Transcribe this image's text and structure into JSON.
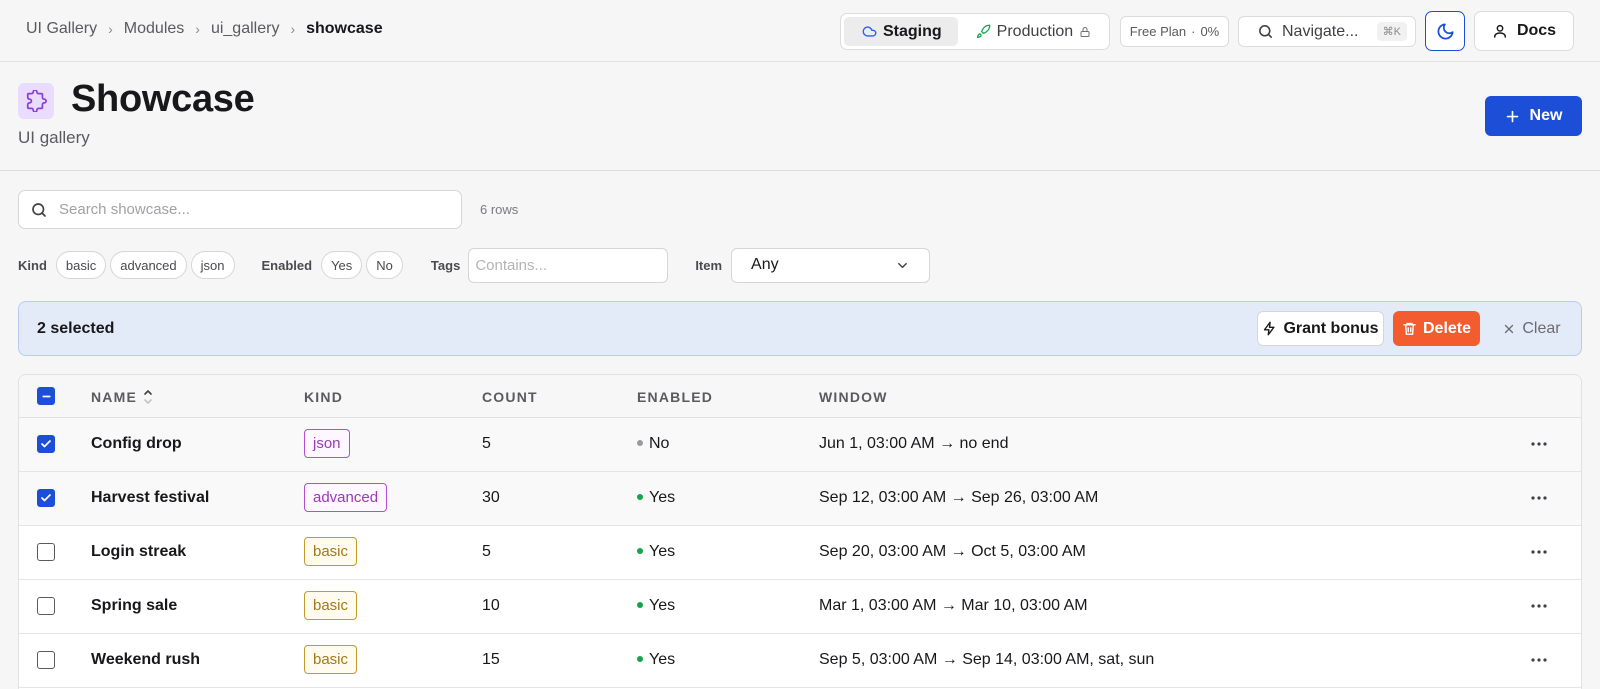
{
  "breadcrumb": [
    "UI Gallery",
    "Modules",
    "ui_gallery",
    "showcase"
  ],
  "env": {
    "staging": "Staging",
    "production": "Production"
  },
  "plan": {
    "label": "Free Plan",
    "usage": "0%"
  },
  "navigate": {
    "label": "Navigate...",
    "shortcut": "⌘K"
  },
  "docs_label": "Docs",
  "page": {
    "title": "Showcase",
    "subtitle": "UI gallery",
    "new_label": "New"
  },
  "search": {
    "placeholder": "Search showcase...",
    "row_count": "6 rows"
  },
  "filters": {
    "kind_label": "Kind",
    "kind_options": [
      "basic",
      "advanced",
      "json"
    ],
    "enabled_label": "Enabled",
    "enabled_options": [
      "Yes",
      "No"
    ],
    "tags_label": "Tags",
    "tags_placeholder": "Contains...",
    "item_label": "Item",
    "item_value": "Any"
  },
  "selection": {
    "text": "2 selected",
    "grant_label": "Grant bonus",
    "delete_label": "Delete",
    "clear_label": "Clear"
  },
  "table": {
    "columns": [
      "NAME",
      "KIND",
      "COUNT",
      "ENABLED",
      "WINDOW"
    ],
    "rows": [
      {
        "name": "Config drop",
        "kind": "json",
        "count": "5",
        "enabled": "No",
        "window": "Jun 1, 03:00 AM → no end",
        "checked": true
      },
      {
        "name": "Harvest festival",
        "kind": "advanced",
        "count": "30",
        "enabled": "Yes",
        "window": "Sep 12, 03:00 AM → Sep 26, 03:00 AM",
        "checked": true
      },
      {
        "name": "Login streak",
        "kind": "basic",
        "count": "5",
        "enabled": "Yes",
        "window": "Sep 20, 03:00 AM → Oct 5, 03:00 AM",
        "checked": false
      },
      {
        "name": "Spring sale",
        "kind": "basic",
        "count": "10",
        "enabled": "Yes",
        "window": "Mar 1, 03:00 AM → Mar 10, 03:00 AM",
        "checked": false
      },
      {
        "name": "Weekend rush",
        "kind": "basic",
        "count": "15",
        "enabled": "Yes",
        "window": "Sep 5, 03:00 AM → Sep 14, 03:00 AM, sat, sun",
        "checked": false
      }
    ]
  },
  "colors": {
    "accent": "#1d4ed8",
    "danger": "#f25c2e",
    "selection_bg": "#e4ebf8"
  }
}
